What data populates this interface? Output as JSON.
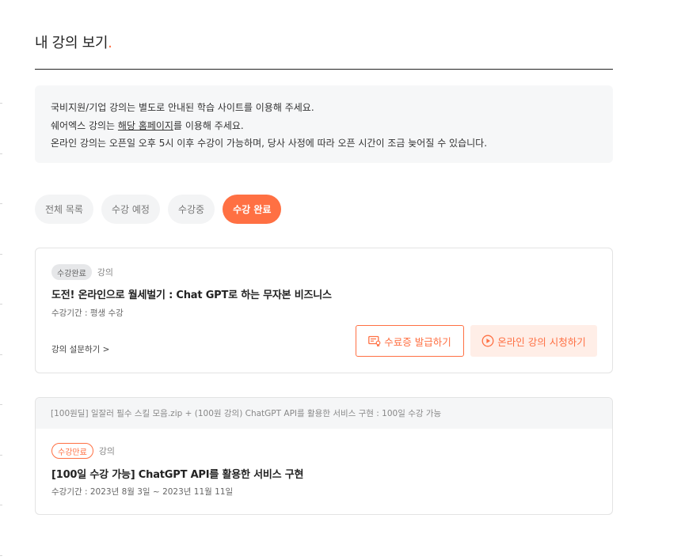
{
  "page": {
    "title": "내 강의 보기",
    "title_dot": "."
  },
  "notice": {
    "line1": "국비지원/기업 강의는 별도로 안내된 학습 사이트를 이용해 주세요.",
    "line2_pre": "쉐어엑스 강의는 ",
    "line2_link": "해당 홈페이지",
    "line2_post": "를 이용해 주세요.",
    "line3": "온라인 강의는 오픈일 오후 5시 이후 수강이 가능하며, 당사 사정에 따라 오픈 시간이 조금 늦어질 수 있습니다."
  },
  "tabs": [
    {
      "label": "전체 목록",
      "active": false
    },
    {
      "label": "수강 예정",
      "active": false
    },
    {
      "label": "수강중",
      "active": false
    },
    {
      "label": "수강 완료",
      "active": true
    }
  ],
  "courses": [
    {
      "badge": "수강완료",
      "kind": "강의",
      "title": "도전! 온라인으로 월세벌기 : Chat GPT로 하는 무자본 비즈니스",
      "period": "수강기간 : 평생 수강",
      "survey": "강의 설문하기 >",
      "btn_certificate": "수료증 발급하기",
      "btn_watch": "온라인 강의 시청하기",
      "icon_certificate": "certificate-icon",
      "icon_watch": "play-circle-icon"
    },
    {
      "package": "[100원딜] 일잘러 필수 스킬 모음.zip + (100원 강의) ChatGPT API를 활용한 서비스 구현 : 100일 수강 가능",
      "badge": "수강만료",
      "kind": "강의",
      "title": "[100일 수강 가능] ChatGPT API를 활용한 서비스 구현",
      "period": "수강기간 : 2023년 8월 3일 ~ 2023년 11월 11일"
    }
  ],
  "colors": {
    "accent": "#ff7043",
    "accent_soft": "#ffeee7",
    "notice_bg": "#f6f7f8"
  }
}
